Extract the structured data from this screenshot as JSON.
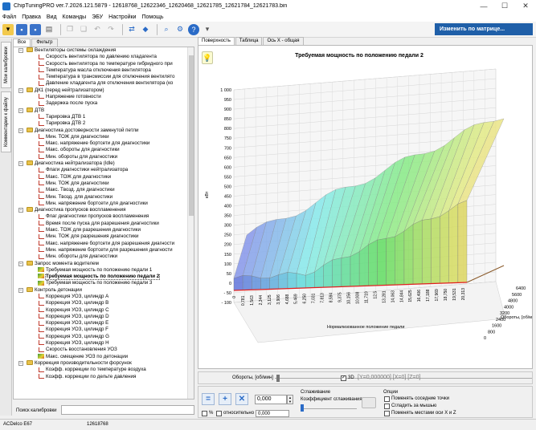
{
  "window": {
    "title": "ChipTuningPRO ver.7.2026.121.5879 - 12618768_12622346_12620468_12621785_12621784_12621783.bin",
    "minimize": "—",
    "maximize": "☐",
    "close": "✕"
  },
  "menu": [
    "Файл",
    "Правка",
    "Вид",
    "Команды",
    "ЭБУ",
    "Настройки",
    "Помощь"
  ],
  "toolbar": {
    "matrix_button": "Изменить по матрице..."
  },
  "left_vtabs": [
    "Мои калибровки",
    "Комментарии к файлу"
  ],
  "tree_tabs": [
    "Все",
    "Фильтр"
  ],
  "tree": [
    {
      "level": 1,
      "type": "folder",
      "label": "Вентиляторы системы охлаждения",
      "exp": "−"
    },
    {
      "level": 2,
      "type": "param",
      "label": "Скорость вентилятора по давлению хладагента"
    },
    {
      "level": 2,
      "type": "param",
      "label": "Скорость вентилятора по температуре гибридного при"
    },
    {
      "level": 2,
      "type": "param",
      "label": "Температура масла отключения вентилятора"
    },
    {
      "level": 2,
      "type": "param",
      "label": "Температура в трансмиссии для отключения вентилято"
    },
    {
      "level": 2,
      "type": "param",
      "label": "Давление хладагента для отключения вентилятора (ко"
    },
    {
      "level": 1,
      "type": "folder",
      "label": "ДК1 (перед нейтрализатором)",
      "exp": "−"
    },
    {
      "level": 2,
      "type": "param",
      "label": "Напряжение готовности"
    },
    {
      "level": 2,
      "type": "param",
      "label": "Задержка после пуска"
    },
    {
      "level": 1,
      "type": "folder",
      "label": "ДТВ",
      "exp": "−"
    },
    {
      "level": 2,
      "type": "param",
      "label": "Тарировка ДТВ 1"
    },
    {
      "level": 2,
      "type": "param",
      "label": "Тарировка ДТВ 2"
    },
    {
      "level": 1,
      "type": "folder",
      "label": "Диагностика достоверности замкнутой петли",
      "exp": "−"
    },
    {
      "level": 2,
      "type": "param",
      "label": "Мин. ТОЖ для диагностики"
    },
    {
      "level": 2,
      "type": "param",
      "label": "Макс. напряжение бортсети для диагностики"
    },
    {
      "level": 2,
      "type": "param",
      "label": "Макс. обороты для диагностики"
    },
    {
      "level": 2,
      "type": "param",
      "label": "Мин. обороты для диагностики"
    },
    {
      "level": 1,
      "type": "folder",
      "label": "Диагностика нейтрализатора (Idle)",
      "exp": "−"
    },
    {
      "level": 2,
      "type": "param",
      "label": "Флаги диагностики нейтрализатора"
    },
    {
      "level": 2,
      "type": "param",
      "label": "Макс. ТОЖ для диагностики"
    },
    {
      "level": 2,
      "type": "param",
      "label": "Мин. ТОЖ для диагностики"
    },
    {
      "level": 2,
      "type": "param",
      "label": "Макс. Tвозд. для диагностики"
    },
    {
      "level": 2,
      "type": "param",
      "label": "Мин. Tвозд. для диагностики"
    },
    {
      "level": 2,
      "type": "param",
      "label": "Мин. напряжение бортсети для диагностики"
    },
    {
      "level": 1,
      "type": "folder",
      "label": "Диагностика пропусков воспламенения",
      "exp": "−"
    },
    {
      "level": 2,
      "type": "param",
      "label": "Флаг диагностики пропусков воспламенения"
    },
    {
      "level": 2,
      "type": "param",
      "label": "Время после пуска для разрешения диагностики"
    },
    {
      "level": 2,
      "type": "param",
      "label": "Макс. ТОЖ для разрешения диагностики"
    },
    {
      "level": 2,
      "type": "param",
      "label": "Мин. ТОЖ для разрешения диагностики"
    },
    {
      "level": 2,
      "type": "param",
      "label": "Макс. напряжение бортсети для разрешения диагности"
    },
    {
      "level": 2,
      "type": "param",
      "label": "Мин. напряжение бортсети для разрешения диагности"
    },
    {
      "level": 2,
      "type": "param",
      "label": "Мин. обороты для диагностики"
    },
    {
      "level": 1,
      "type": "folder",
      "label": "Запрос момента водителем",
      "exp": "−"
    },
    {
      "level": 2,
      "type": "surf",
      "label": "Требуемая мощность по положению педали 1"
    },
    {
      "level": 2,
      "type": "surf",
      "label": "Требуемая мощность по положению педали 2",
      "selected": true
    },
    {
      "level": 2,
      "type": "surf",
      "label": "Требуемая мощность по положению педали 3"
    },
    {
      "level": 1,
      "type": "folder",
      "label": "Контроль детонации",
      "exp": "−"
    },
    {
      "level": 2,
      "type": "param",
      "label": "Коррекция УОЗ, цилиндр A"
    },
    {
      "level": 2,
      "type": "param",
      "label": "Коррекция УОЗ, цилиндр B"
    },
    {
      "level": 2,
      "type": "param",
      "label": "Коррекция УОЗ, цилиндр C"
    },
    {
      "level": 2,
      "type": "param",
      "label": "Коррекция УОЗ, цилиндр D"
    },
    {
      "level": 2,
      "type": "param",
      "label": "Коррекция УОЗ, цилиндр E"
    },
    {
      "level": 2,
      "type": "param",
      "label": "Коррекция УОЗ, цилиндр F"
    },
    {
      "level": 2,
      "type": "param",
      "label": "Коррекция УОЗ, цилиндр G"
    },
    {
      "level": 2,
      "type": "param",
      "label": "Коррекция УОЗ, цилиндр H"
    },
    {
      "level": 2,
      "type": "param",
      "label": "Скорость восстановления УОЗ"
    },
    {
      "level": 2,
      "type": "surf",
      "label": "Макс. смещение УОЗ по детонации"
    },
    {
      "level": 1,
      "type": "folder",
      "label": "Коррекция производительности форсунок",
      "exp": "−"
    },
    {
      "level": 2,
      "type": "param",
      "label": "Коэфф. коррекции по температуре воздуха"
    },
    {
      "level": 2,
      "type": "param",
      "label": "Коэфф. коррекции по дельте давления"
    }
  ],
  "search": {
    "label": "Поиск калибровки"
  },
  "right_tabs": [
    "Поверхность",
    "Таблица",
    "Ось X - общая"
  ],
  "chart": {
    "title": "Требуемая мощность по положению педали 2",
    "z_label": "кВт",
    "x_label": "Нормализованное положение педали",
    "y_label": "Обороты, [об/мин]",
    "z_ticks": [
      "1 000",
      "950",
      "900",
      "850",
      "800",
      "750",
      "700",
      "650",
      "600",
      "550",
      "500",
      "450",
      "400",
      "350",
      "300",
      "250",
      "200",
      "150",
      "100",
      "50",
      "0",
      "- 50",
      "- 100"
    ],
    "x_ticks": [
      "0",
      "0,391",
      "0,781",
      "1,172",
      "1,563",
      "1,953",
      "2,344",
      "2,734",
      "3,125",
      "3,516",
      "3,906",
      "4,297",
      "4,688",
      "5,078",
      "5,469",
      "5,859",
      "6,250",
      "6,641",
      "7,031",
      "7,422",
      "7,813",
      "8,203",
      "8,594",
      "8,984",
      "9,375",
      "9,766",
      "10,156",
      "10,547",
      "10,938",
      "11,328",
      "11,719",
      "12,109",
      "12,5",
      "12,891",
      "13,281",
      "13,672",
      "14,063",
      "14,453",
      "14,844",
      "15,234",
      "15,625",
      "15,997",
      "16,406",
      "16,797",
      "17,188",
      "17,578",
      "17,969",
      "18,359",
      "18,750",
      "19,141",
      "19,531",
      "19,922",
      "20,313"
    ],
    "y_ticks": [
      "0",
      "800",
      "1600",
      "2400",
      "3200",
      "4000",
      "4800",
      "5600",
      "6400"
    ]
  },
  "slider": {
    "label": "Обороты, [об/мин]",
    "check3d": "3D",
    "coords": "[Y=0,000000]  [X=0]  [Z=0]"
  },
  "bottom": {
    "value": "0,000",
    "pct": "%",
    "relative_label": "относительно",
    "relative_value": "0,000",
    "smoothing_title": "Сглаживание",
    "smoothing_coef": "Коэффициент сглаживания",
    "options_title": "Опции",
    "opt1": "Поменять соседние точки",
    "opt2": "Сгладить за мышью",
    "opt3": "Поменять местами оси X и Z"
  },
  "status": {
    "ecu": "ACDelco E67",
    "id": "12618768"
  }
}
